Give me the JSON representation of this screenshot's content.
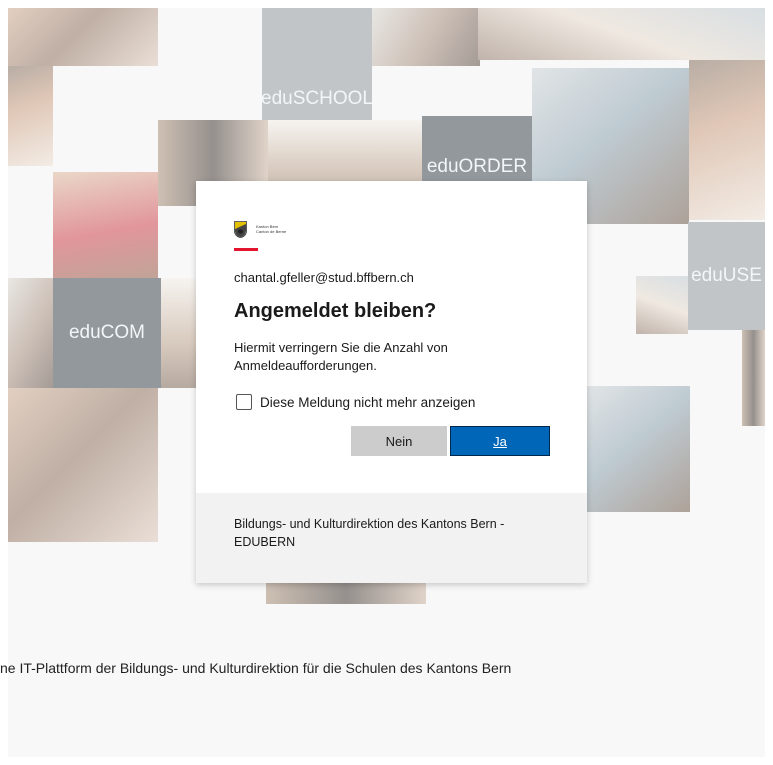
{
  "background": {
    "tiles": {
      "school": "eduSCHOOL",
      "order": "eduORDER",
      "com": "eduCOM",
      "user": "eduUSE"
    },
    "tagline": "ne IT-Plattform der Bildungs- und Kulturdirektion für die Schulen des Kantons Bern"
  },
  "dialog": {
    "logo": {
      "icon": "bern-crest-icon",
      "line1": "Kanton Bern",
      "line2": "Canton de Berne",
      "accent_color": "#e3142e"
    },
    "email": "chantal.gfeller@stud.bffbern.ch",
    "title": "Angemeldet bleiben?",
    "description": "Hiermit verringern Sie die Anzahl von Anmeldeaufforderungen.",
    "checkbox_label": "Diese Meldung nicht mehr anzeigen",
    "checkbox_checked": false,
    "buttons": {
      "no": "Nein",
      "yes": "Ja"
    },
    "primary_color": "#0067b8",
    "footer_text": "Bildungs- und Kulturdirektion des Kantons Bern - EDUBERN"
  }
}
